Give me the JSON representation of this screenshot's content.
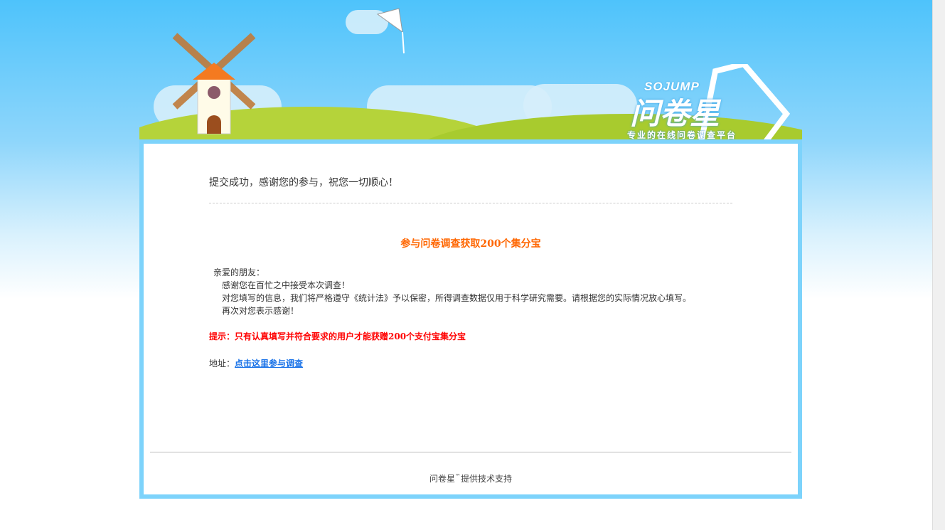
{
  "banner": {
    "logo_en": "SOJUMP",
    "logo_cn": "问卷星",
    "slogan": "专业的在线问卷调查平台"
  },
  "main": {
    "title": "提交成功，感谢您的参与，祝您一切顺心！",
    "heading": "参与问卷调查获取200个集分宝",
    "letter": {
      "greeting": "亲爱的朋友：",
      "lines": [
        "感谢您在百忙之中接受本次调查！",
        "对您填写的信息，我们将严格遵守《统计法》予以保密，所得调查数据仅用于科学研究需要。请根据您的实际情况放心填写。",
        "再次对您表示感谢！"
      ]
    },
    "tip": "提示：只有认真填写并符合要求的用户才能获赠200个支付宝集分宝",
    "address_label": "地址：",
    "address_link": "点击这里参与调查"
  },
  "footer": {
    "brand": "问卷星",
    "tm": "™",
    "text": "提供技术支持"
  },
  "colors": {
    "accent_orange": "#ff6600",
    "tip_red": "#ff0000",
    "link_blue": "#1a73e8",
    "box_border": "#7dd3fb"
  }
}
